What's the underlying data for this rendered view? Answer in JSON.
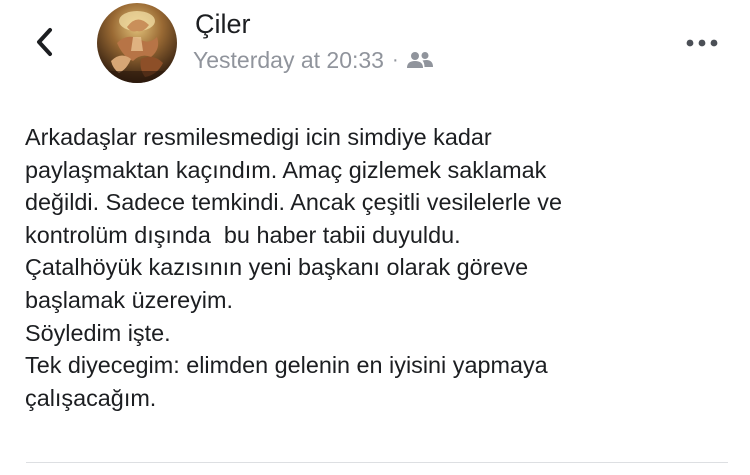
{
  "header": {
    "author_name": "Çiler",
    "timestamp": "Yesterday at 20:33",
    "separator": "·",
    "audience_icon": "friends-icon",
    "back_icon": "chevron-left-icon",
    "more_icon": "more-options-icon"
  },
  "post": {
    "lines": [
      "Arkadaşlar resmilesmedigi icin simdiye kadar",
      "paylaşmaktan kaçındım. Amaç gizlemek saklamak",
      "değildi. Sadece temkindi. Ancak çeşitli vesilelerle ve",
      "kontrolüm dışında  bu haber tabii duyuldu.",
      "Çatalhöyük kazısının yeni başkanı olarak göreve",
      "başlamak üzereyim.",
      "Söyledim işte.",
      "Tek diyecegim: elimden gelenin en iyisini yapmaya",
      "çalışacağım."
    ]
  },
  "colors": {
    "text": "#1c1e21",
    "meta": "#90949c",
    "icon": "#4b4f56",
    "divider": "#dddfe2"
  }
}
